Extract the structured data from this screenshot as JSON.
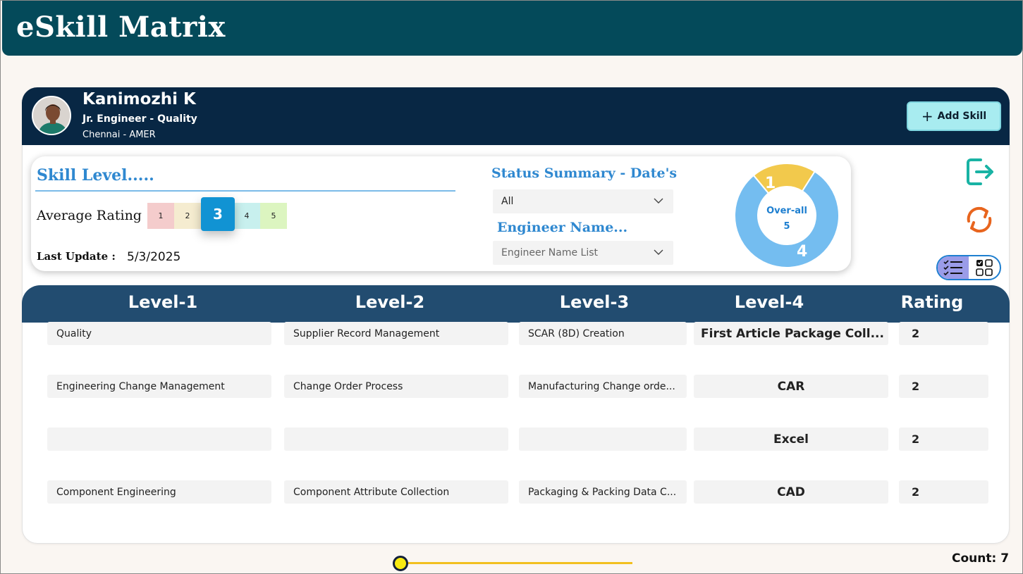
{
  "app": {
    "title": "eSkill Matrix"
  },
  "profile": {
    "name": "Kanimozhi K",
    "role": "Jr. Engineer - Quality",
    "location": "Chennai - AMER",
    "add_skill_label": "Add Skill"
  },
  "summary": {
    "skill_level_title": "Skill Level.....",
    "average_rating_label": "Average Rating",
    "rating_scale": [
      {
        "label": "1",
        "color": "#f4cccc"
      },
      {
        "label": "2",
        "color": "#f5ecd0"
      },
      {
        "label": "3",
        "color": "#1193d3"
      },
      {
        "label": "4",
        "color": "#c8f0ee"
      },
      {
        "label": "5",
        "color": "#dcf5c0"
      }
    ],
    "average_rating_value": 3,
    "last_update_label": "Last Update :",
    "last_update_value": "5/3/2025",
    "status_title": "Status Summary - Date's",
    "status_dropdown_value": "All",
    "engineer_title": "Engineer Name...",
    "engineer_dropdown_placeholder": "Engineer Name List"
  },
  "chart_data": {
    "type": "pie",
    "categories": [
      "1",
      "4"
    ],
    "values": [
      1,
      4
    ],
    "colors": [
      "#f2c94c",
      "#74bdf0"
    ],
    "center_label": "Over-all",
    "center_value": "5"
  },
  "icons": {
    "exit": "exit-icon",
    "refresh": "refresh-icon",
    "list_view": "checklist-icon",
    "grid_view": "grid-icon"
  },
  "table": {
    "headers": [
      "Level-1",
      "Level-2",
      "Level-3",
      "Level-4",
      "Rating"
    ],
    "rows": [
      {
        "l1": "Quality",
        "l2": "Supplier Record Management",
        "l3": "SCAR (8D) Creation",
        "l4": "First Article Package Coll...",
        "rating": "2"
      },
      {
        "l1": "Engineering Change Management",
        "l2": "Change Order Process",
        "l3": "Manufacturing Change orde...",
        "l4": "CAR",
        "rating": "2"
      },
      {
        "l1": "",
        "l2": "",
        "l3": "",
        "l4": "Excel",
        "rating": "2"
      },
      {
        "l1": "Component Engineering",
        "l2": "Component Attribute Collection",
        "l3": "Packaging & Packing Data C...",
        "l4": "CAD",
        "rating": "2"
      }
    ]
  },
  "footer": {
    "count_text": "Count: 7",
    "slider_position": 0
  }
}
